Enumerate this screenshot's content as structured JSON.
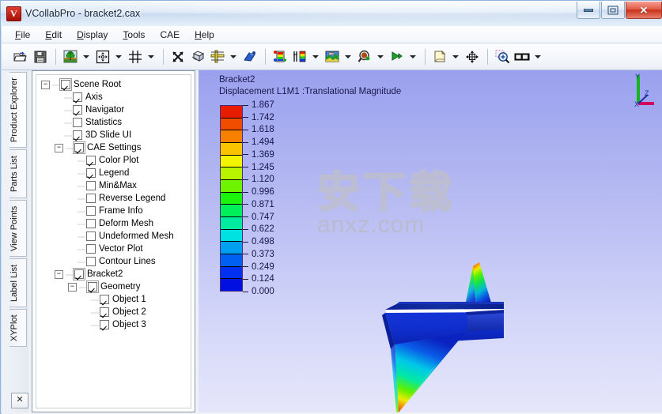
{
  "window": {
    "app_icon": "vcollab-logo-icon",
    "title": "VCollabPro - bracket2.cax",
    "buttons": {
      "minimize": "minimize",
      "maximize": "restore",
      "close": "✕"
    }
  },
  "menubar": {
    "items": [
      {
        "name": "file",
        "pre": "",
        "accel": "F",
        "post": "ile"
      },
      {
        "name": "edit",
        "pre": "",
        "accel": "E",
        "post": "dit"
      },
      {
        "name": "display",
        "pre": "",
        "accel": "D",
        "post": "isplay"
      },
      {
        "name": "tools",
        "pre": "",
        "accel": "T",
        "post": "ools"
      },
      {
        "name": "cae",
        "pre": "",
        "accel": "C",
        "post": "AE"
      },
      {
        "name": "help",
        "pre": "",
        "accel": "H",
        "post": "elp"
      }
    ]
  },
  "toolbar": {
    "items": [
      {
        "name": "open-file-button",
        "icon": "open-folder-icon",
        "dropdown": false
      },
      {
        "name": "save-file-button",
        "icon": "floppy-save-icon",
        "dropdown": false
      },
      {
        "name": "separator-1",
        "icon": "separator",
        "dropdown": false
      },
      {
        "name": "scene-background-button",
        "icon": "tree-scene-icon",
        "dropdown": true
      },
      {
        "name": "fit-view-button",
        "icon": "fit-to-window-icon",
        "dropdown": true
      },
      {
        "name": "grid-button",
        "icon": "grid-icon",
        "dropdown": true
      },
      {
        "name": "separator-2",
        "icon": "separator",
        "dropdown": false
      },
      {
        "name": "rotate-button",
        "icon": "rotate-arrows-icon",
        "dropdown": false
      },
      {
        "name": "box-view-button",
        "icon": "wireframe-box-icon",
        "dropdown": false
      },
      {
        "name": "section-cut-button",
        "icon": "section-plane-icon",
        "dropdown": true
      },
      {
        "name": "light-button",
        "icon": "spotlight-icon",
        "dropdown": false
      },
      {
        "name": "separator-3",
        "icon": "separator",
        "dropdown": false
      },
      {
        "name": "color-plot-button",
        "icon": "color-plot-icon",
        "dropdown": false
      },
      {
        "name": "legend-button",
        "icon": "legend-bar-icon",
        "dropdown": true
      },
      {
        "name": "contour-button",
        "icon": "contour-map-icon",
        "dropdown": true
      },
      {
        "name": "probe-button",
        "icon": "probe-magnifier-icon",
        "dropdown": true
      },
      {
        "name": "animate-button",
        "icon": "play-animation-icon",
        "dropdown": true
      },
      {
        "name": "separator-4",
        "icon": "separator",
        "dropdown": false
      },
      {
        "name": "note-button",
        "icon": "note-page-icon",
        "dropdown": true
      },
      {
        "name": "move-label-button",
        "icon": "move-crosshair-icon",
        "dropdown": false
      },
      {
        "name": "separator-5",
        "icon": "separator",
        "dropdown": false
      },
      {
        "name": "zoom-box-button",
        "icon": "zoom-region-icon",
        "dropdown": false
      },
      {
        "name": "image-capture-button",
        "icon": "screen-capture-icon",
        "dropdown": true
      }
    ]
  },
  "side_tabs": {
    "items": [
      {
        "name": "product-explorer",
        "label": "Product Explorer",
        "active": true
      },
      {
        "name": "parts-list",
        "label": "Parts List",
        "active": false
      },
      {
        "name": "view-points",
        "label": "View Points",
        "active": false
      },
      {
        "name": "label-list",
        "label": "Label List",
        "active": false
      },
      {
        "name": "xyplot",
        "label": "XYPlot",
        "active": false
      }
    ],
    "close_label": "✕"
  },
  "tree": {
    "nodes": [
      {
        "name": "scene-root",
        "label": "Scene Root",
        "depth": 0,
        "toggle": "minus",
        "checked": true,
        "box": true
      },
      {
        "name": "axis",
        "label": "Axis",
        "depth": 1,
        "toggle": "none",
        "checked": true,
        "box": false
      },
      {
        "name": "navigator",
        "label": "Navigator",
        "depth": 1,
        "toggle": "none",
        "checked": true,
        "box": false
      },
      {
        "name": "statistics",
        "label": "Statistics",
        "depth": 1,
        "toggle": "none",
        "checked": false,
        "box": false
      },
      {
        "name": "3d-slide-ui",
        "label": "3D Slide UI",
        "depth": 1,
        "toggle": "none",
        "checked": true,
        "box": false
      },
      {
        "name": "cae-settings",
        "label": "CAE Settings",
        "depth": 1,
        "toggle": "minus",
        "checked": true,
        "box": true
      },
      {
        "name": "color-plot",
        "label": "Color Plot",
        "depth": 2,
        "toggle": "none",
        "checked": true,
        "box": false
      },
      {
        "name": "legend",
        "label": "Legend",
        "depth": 2,
        "toggle": "none",
        "checked": true,
        "box": false
      },
      {
        "name": "min-and-max",
        "label": "Min&Max",
        "depth": 2,
        "toggle": "none",
        "checked": false,
        "box": false
      },
      {
        "name": "reverse-legend",
        "label": "Reverse Legend",
        "depth": 2,
        "toggle": "none",
        "checked": false,
        "box": false
      },
      {
        "name": "frame-info",
        "label": "Frame Info",
        "depth": 2,
        "toggle": "none",
        "checked": false,
        "box": false
      },
      {
        "name": "deform-mesh",
        "label": "Deform Mesh",
        "depth": 2,
        "toggle": "none",
        "checked": false,
        "box": false
      },
      {
        "name": "undeformed-mesh",
        "label": "Undeformed Mesh",
        "depth": 2,
        "toggle": "none",
        "checked": false,
        "box": false
      },
      {
        "name": "vector-plot",
        "label": "Vector Plot",
        "depth": 2,
        "toggle": "none",
        "checked": false,
        "box": false
      },
      {
        "name": "contour-lines",
        "label": "Contour Lines",
        "depth": 2,
        "toggle": "none",
        "checked": false,
        "box": false
      },
      {
        "name": "bracket2",
        "label": "Bracket2",
        "depth": 1,
        "toggle": "minus",
        "checked": true,
        "box": true
      },
      {
        "name": "geometry",
        "label": "Geometry",
        "depth": 2,
        "toggle": "minus",
        "checked": true,
        "box": true
      },
      {
        "name": "object-1",
        "label": "Object 1",
        "depth": 3,
        "toggle": "none",
        "checked": true,
        "box": false
      },
      {
        "name": "object-2",
        "label": "Object 2",
        "depth": 3,
        "toggle": "none",
        "checked": true,
        "box": false
      },
      {
        "name": "object-3",
        "label": "Object 3",
        "depth": 3,
        "toggle": "none",
        "checked": true,
        "box": false
      }
    ]
  },
  "viewport": {
    "model_title": "Bracket2",
    "result_title": "Displacement L1M1 :Translational Magnitude",
    "watermark_cn": "安下载",
    "watermark_en": "anxz.com",
    "axis_triad": {
      "x_label": "X",
      "y_label": "Y",
      "z_label": "Z",
      "x_color": "#d4005e",
      "y_color": "#16b41f",
      "z_color": "#1a2fa8"
    }
  },
  "chart_data": {
    "type": "heatmap",
    "title": "Displacement L1M1 :Translational Magnitude",
    "subtitle": "Bracket2",
    "legend_position": "left",
    "ylabel": "Translational Magnitude",
    "units": "",
    "tick_labels": [
      "1.867",
      "1.742",
      "1.618",
      "1.494",
      "1.369",
      "1.245",
      "1.120",
      "0.996",
      "0.871",
      "0.747",
      "0.622",
      "0.498",
      "0.373",
      "0.249",
      "0.124",
      "0.000"
    ],
    "tick_values": [
      1.867,
      1.742,
      1.618,
      1.494,
      1.369,
      1.245,
      1.12,
      0.996,
      0.871,
      0.747,
      0.622,
      0.498,
      0.373,
      0.249,
      0.124,
      0.0
    ],
    "range": [
      0.0,
      1.867
    ],
    "band_count": 15,
    "band_colors": [
      "#e81d00",
      "#f04d00",
      "#f78000",
      "#fbc400",
      "#f2f400",
      "#b8f400",
      "#6ef400",
      "#1df40e",
      "#00f05a",
      "#00eaa0",
      "#00e2e2",
      "#009ff0",
      "#0060f2",
      "#0030f0",
      "#0010e0"
    ]
  }
}
